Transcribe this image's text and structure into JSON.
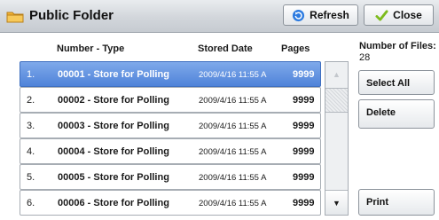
{
  "header": {
    "title": "Public Folder",
    "refresh_label": "Refresh",
    "close_label": "Close"
  },
  "columns": {
    "number_type": "Number - Type",
    "stored_date": "Stored Date",
    "pages": "Pages"
  },
  "rows": [
    {
      "index": "1.",
      "name": "00001 - Store for Polling",
      "date": "2009/4/16 11:55 A",
      "pages": "9999",
      "selected": true
    },
    {
      "index": "2.",
      "name": "00002 - Store for Polling",
      "date": "2009/4/16 11:55 A",
      "pages": "9999"
    },
    {
      "index": "3.",
      "name": "00003 - Store for Polling",
      "date": "2009/4/16 11:55 A",
      "pages": "9999"
    },
    {
      "index": "4.",
      "name": "00004 - Store for Polling",
      "date": "2009/4/16 11:55 A",
      "pages": "9999"
    },
    {
      "index": "5.",
      "name": "00005 - Store for Polling",
      "date": "2009/4/16 11:55 A",
      "pages": "9999"
    },
    {
      "index": "6.",
      "name": "00006 - Store for Polling",
      "date": "2009/4/16 11:55 A",
      "pages": "9999"
    }
  ],
  "sidebar": {
    "files_label": "Number of Files:",
    "files_count": "28",
    "select_all_label": "Select All",
    "delete_label": "Delete",
    "print_label": "Print"
  },
  "scroll": {
    "up_glyph": "▲",
    "down_glyph": "▼"
  },
  "colors": {
    "selected_row": "#5b8fe0",
    "folder_icon": "#f2b233",
    "refresh_icon": "#2d7be0",
    "close_check": "#7dbb1c"
  }
}
